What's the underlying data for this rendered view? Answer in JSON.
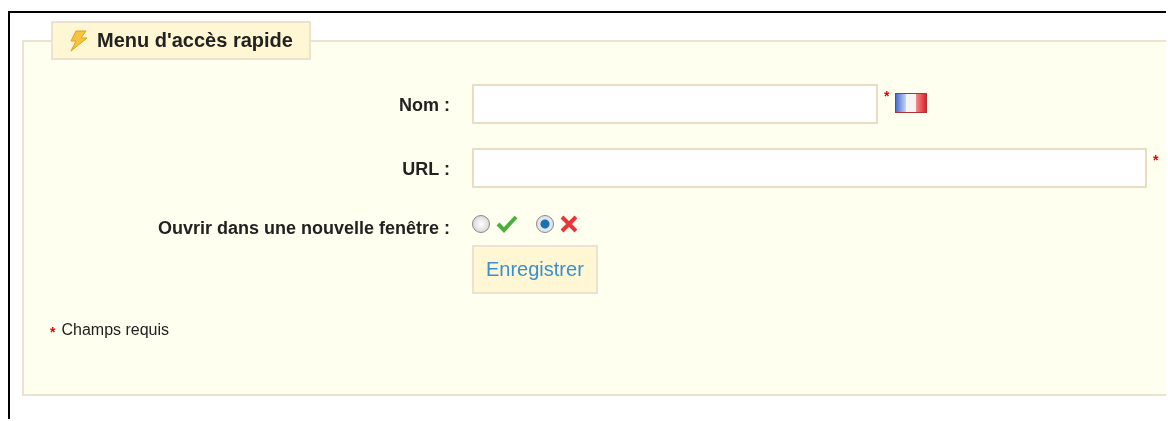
{
  "panel": {
    "title": "Menu d'accès rapide"
  },
  "fields": [
    {
      "kind": "text",
      "label": "Nom :",
      "required_mark": "*",
      "language_flag": true
    },
    {
      "kind": "text",
      "label": "URL :",
      "required_mark": "*",
      "language_flag": false
    },
    {
      "kind": "radio",
      "label": "Ouvrir dans une nouvelle fenêtre :",
      "options": [
        {
          "kind": "yes",
          "selected": false
        },
        {
          "kind": "no",
          "selected": true
        }
      ]
    }
  ],
  "submit_button": {
    "label": "Enregistrer"
  },
  "footnote": {
    "mark": "*",
    "text": "Champs requis"
  }
}
